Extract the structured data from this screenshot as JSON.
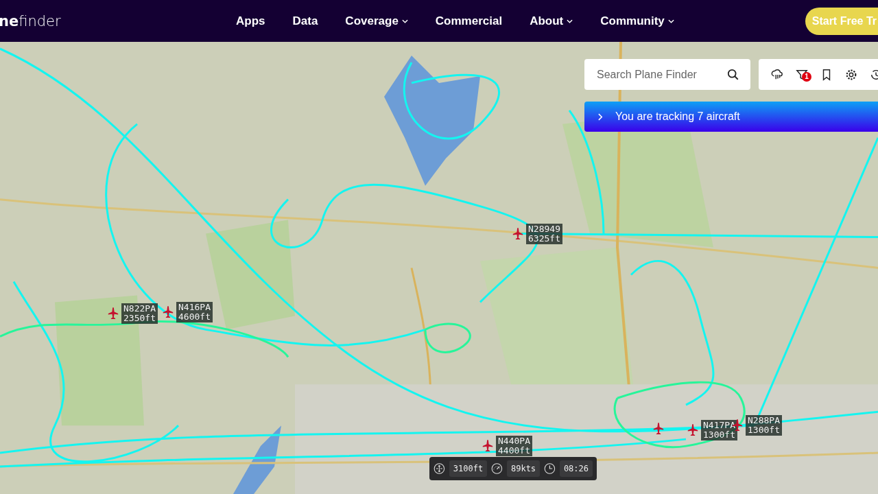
{
  "header": {
    "logo": "**ne**finder",
    "nav": [
      {
        "label": "Apps",
        "dropdown": false
      },
      {
        "label": "Data",
        "dropdown": false
      },
      {
        "label": "Coverage",
        "dropdown": true
      },
      {
        "label": "Commercial",
        "dropdown": false
      },
      {
        "label": "About",
        "dropdown": true
      },
      {
        "label": "Community",
        "dropdown": true
      }
    ],
    "cta": "Start Free Tr"
  },
  "search": {
    "placeholder": "Search Plane Finder"
  },
  "toolbar": {
    "filter_badge": "1"
  },
  "banner": {
    "text": "You are tracking 7 aircraft"
  },
  "aircraft": [
    {
      "kind": "labeled",
      "callsign": "N28949",
      "altitude": "6325ft"
    },
    {
      "kind": "labeled",
      "callsign": "N822PA",
      "altitude": "2350ft"
    },
    {
      "kind": "labeled",
      "callsign": "N416PA",
      "altitude": "4600ft"
    },
    {
      "kind": "labeled",
      "callsign": "N440PA",
      "altitude": "4400ft"
    },
    {
      "kind": "labeled",
      "callsign": "N417PA",
      "altitude": "1300ft"
    },
    {
      "kind": "labeled",
      "callsign": "N288PA",
      "altitude": "1300ft"
    },
    {
      "kind": "unlabeled"
    }
  ],
  "selected_info": {
    "altitude": "3100ft",
    "speed": "89kts",
    "time": "08:26"
  }
}
